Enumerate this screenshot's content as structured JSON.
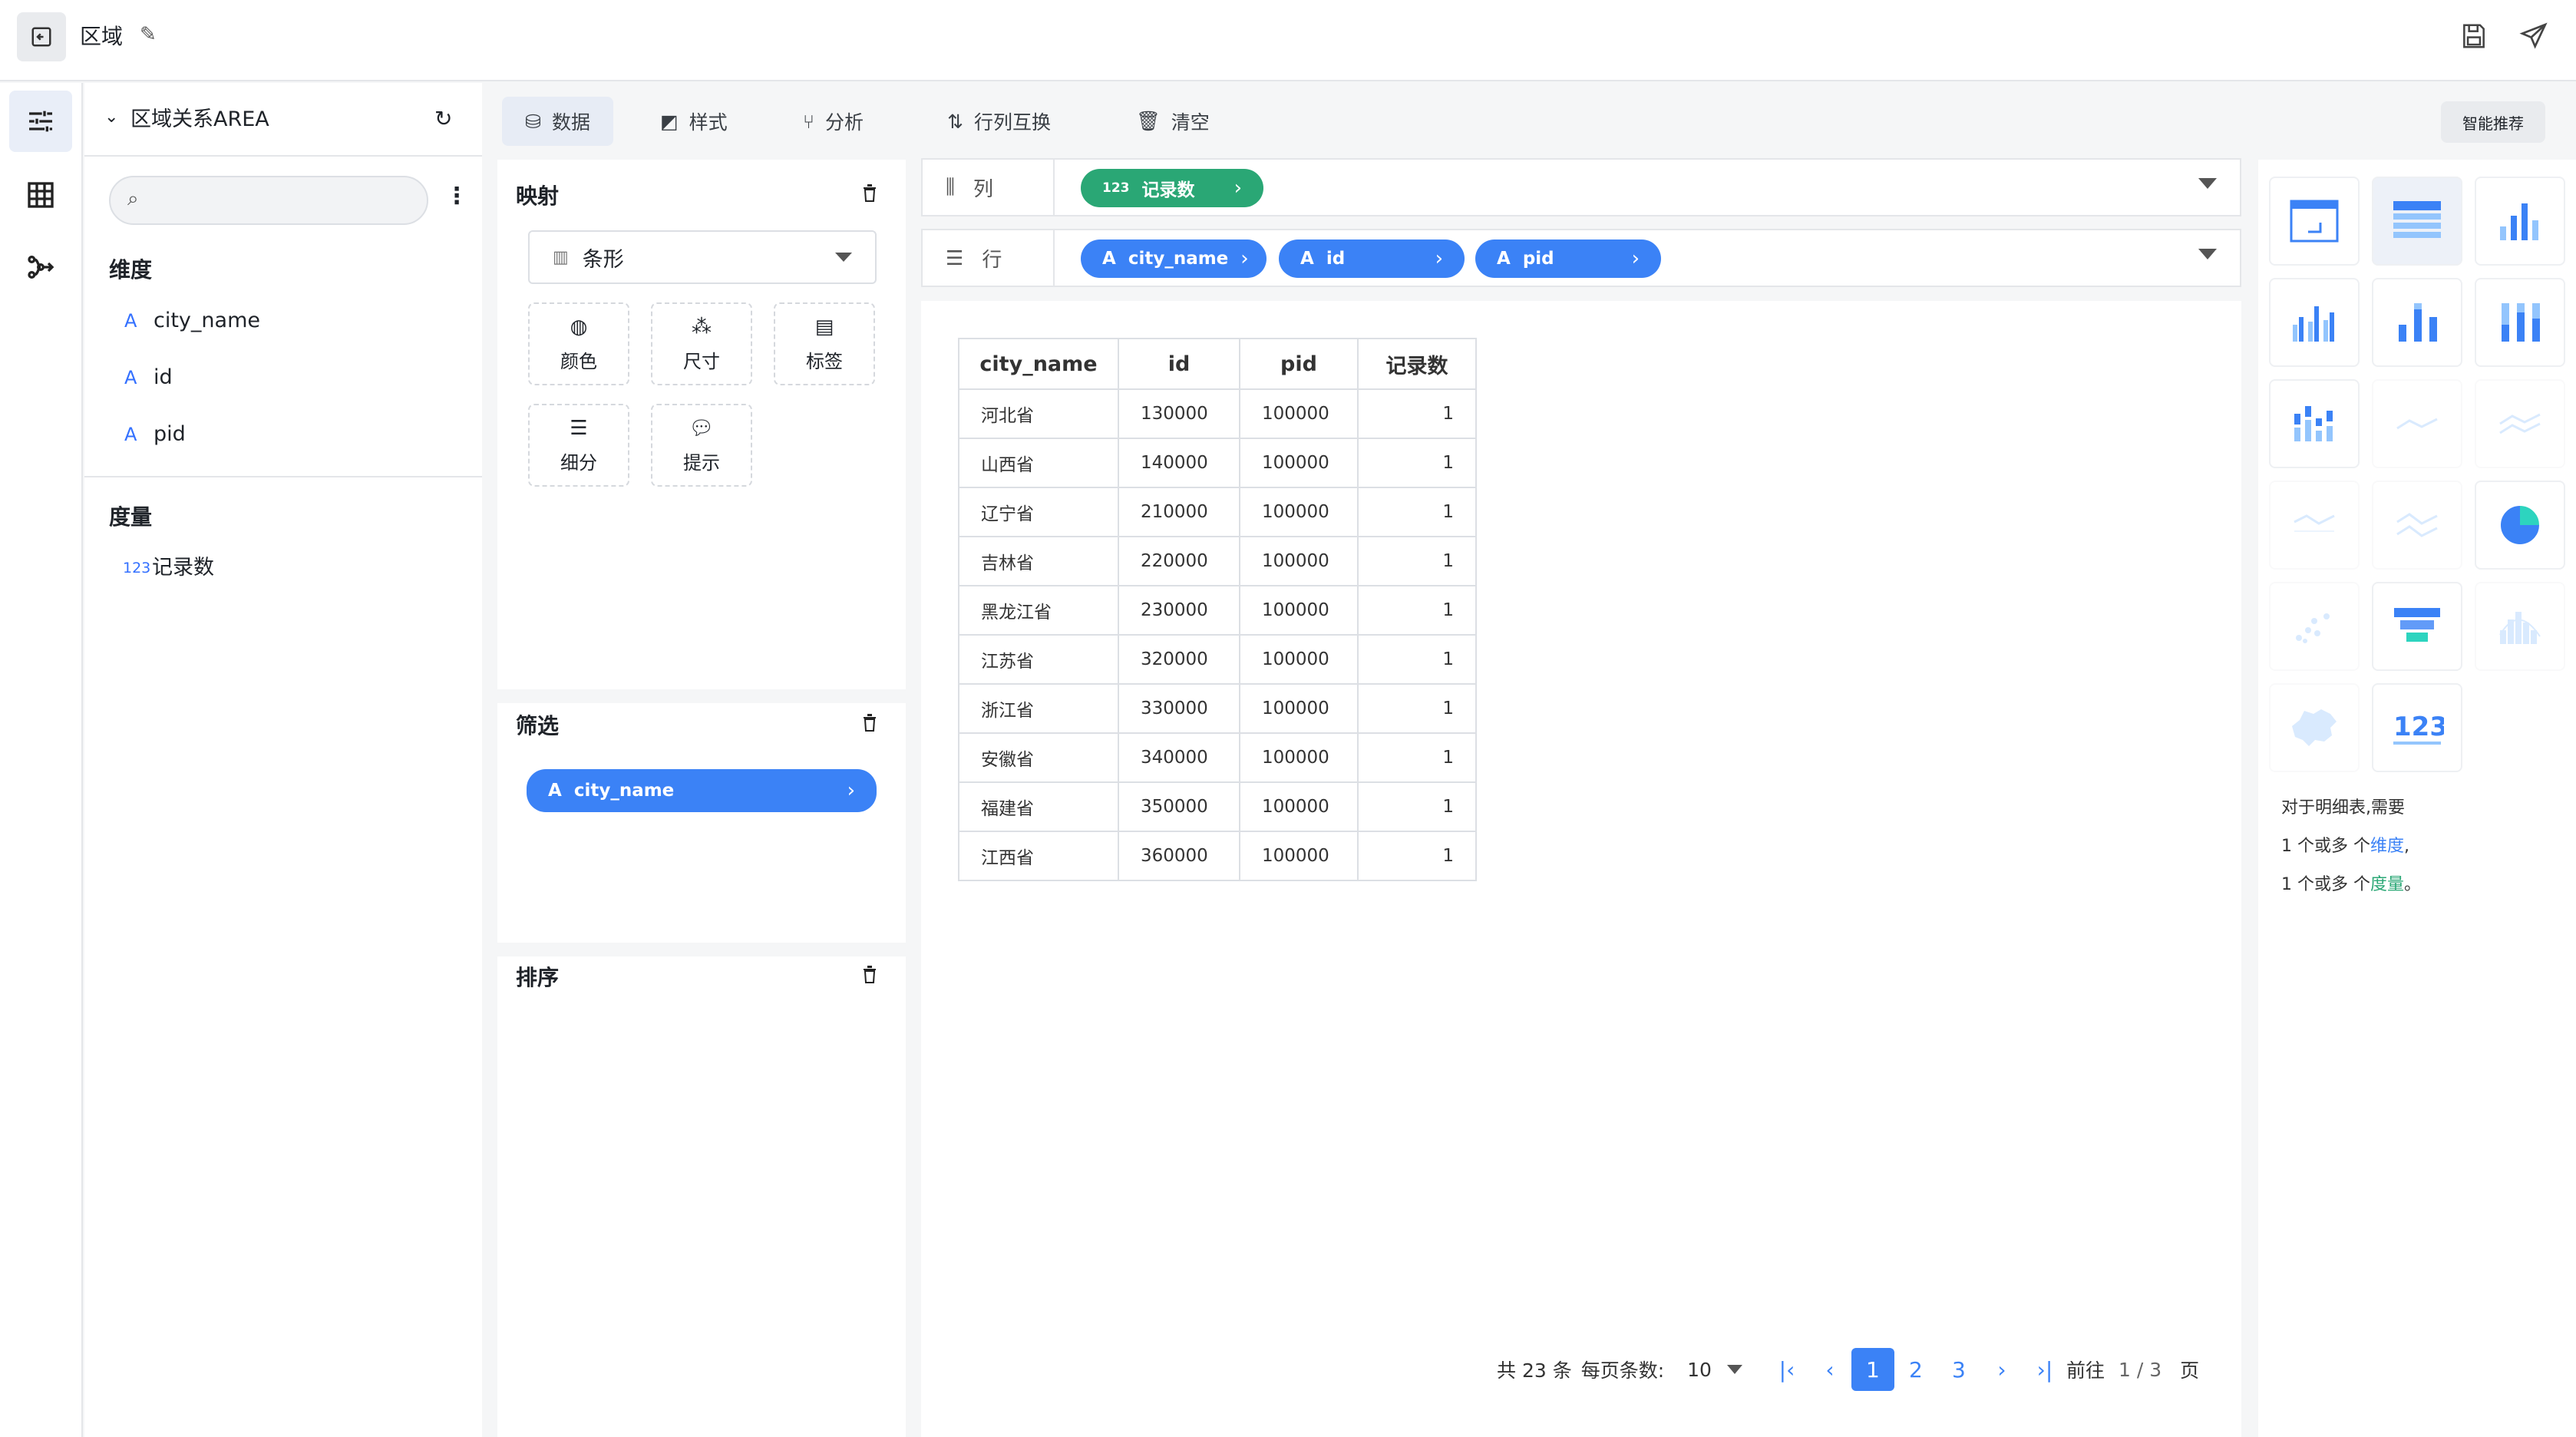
{
  "header": {
    "title": "区域"
  },
  "datasource": {
    "name": "区域关系AREA",
    "search_placeholder": ""
  },
  "dimensions": {
    "title": "维度",
    "items": [
      {
        "type": "A",
        "name": "city_name"
      },
      {
        "type": "A",
        "name": "id"
      },
      {
        "type": "A",
        "name": "pid"
      }
    ]
  },
  "measures": {
    "title": "度量",
    "items": [
      {
        "type": "123",
        "name": "记录数"
      }
    ]
  },
  "tabs": [
    {
      "label": "数据",
      "active": true
    },
    {
      "label": "样式"
    },
    {
      "label": "分析"
    },
    {
      "label": "行列互换"
    },
    {
      "label": "清空"
    }
  ],
  "smart_recommend": "智能推荐",
  "mapping": {
    "title": "映射",
    "chart_select": "条形",
    "marks": [
      "颜色",
      "尺寸",
      "标签",
      "细分",
      "提示"
    ]
  },
  "filter": {
    "title": "筛选",
    "pill": "city_name",
    "pill_type": "A"
  },
  "sort": {
    "title": "排序"
  },
  "shelves": {
    "columns": {
      "label": "列",
      "pills": [
        {
          "type": "123",
          "name": "记录数"
        }
      ]
    },
    "rows": {
      "label": "行",
      "pills": [
        {
          "type": "A",
          "name": "city_name"
        },
        {
          "type": "A",
          "name": "id"
        },
        {
          "type": "A",
          "name": "pid"
        }
      ]
    }
  },
  "table": {
    "headers": [
      "city_name",
      "id",
      "pid",
      "记录数"
    ],
    "rows": [
      [
        "河北省",
        "130000",
        "100000",
        "1"
      ],
      [
        "山西省",
        "140000",
        "100000",
        "1"
      ],
      [
        "辽宁省",
        "210000",
        "100000",
        "1"
      ],
      [
        "吉林省",
        "220000",
        "100000",
        "1"
      ],
      [
        "黑龙江省",
        "230000",
        "100000",
        "1"
      ],
      [
        "江苏省",
        "320000",
        "100000",
        "1"
      ],
      [
        "浙江省",
        "330000",
        "100000",
        "1"
      ],
      [
        "安徽省",
        "340000",
        "100000",
        "1"
      ],
      [
        "福建省",
        "350000",
        "100000",
        "1"
      ],
      [
        "江西省",
        "360000",
        "100000",
        "1"
      ]
    ]
  },
  "pagination": {
    "total": "共 23 条",
    "per_page_label": "每页条数:",
    "per_page": "10",
    "pages": [
      "1",
      "2",
      "3"
    ],
    "current": "1",
    "goto": "前往",
    "page_info": "1 / 3",
    "page_unit": "页"
  },
  "chart_types": [
    "table-pivot",
    "table-detail",
    "bar",
    "bar-grouped",
    "bar-stacked",
    "bar-percent",
    "bar-horizontal",
    "line",
    "line-multi",
    "area",
    "area-stacked",
    "pie",
    "scatter",
    "funnel",
    "histogram",
    "map",
    "kpi-number"
  ],
  "hint": {
    "line1": "对于明细表,需要",
    "line2_pre": "1 个或多 个",
    "line2_em": "维度",
    "line2_post": ",",
    "line3_pre": "1 个或多 个",
    "line3_em": "度量",
    "line3_post": "。"
  },
  "colors": {
    "primary": "#3b82f6",
    "green": "#2aa775"
  }
}
